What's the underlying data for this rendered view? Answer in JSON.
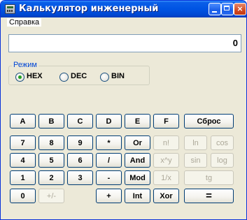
{
  "window": {
    "title": "Калькулятор инженерный",
    "controls": {
      "minimize": "minimize",
      "maximize": "maximize",
      "close": "×"
    }
  },
  "menu": {
    "items": [
      {
        "label": "Справка"
      }
    ]
  },
  "display": {
    "value": "0"
  },
  "mode": {
    "legend": "Режим",
    "options": [
      {
        "label": "HEX",
        "selected": true
      },
      {
        "label": "DEC",
        "selected": false
      },
      {
        "label": "BIN",
        "selected": false
      }
    ]
  },
  "keys": {
    "a": "A",
    "b": "B",
    "c": "C",
    "d": "D",
    "e": "E",
    "f": "F",
    "reset": "Сброс",
    "k7": "7",
    "k8": "8",
    "k9": "9",
    "mul": "*",
    "or": "Or",
    "fact": "n!",
    "ln": "ln",
    "cos": "cos",
    "k4": "4",
    "k5": "5",
    "k6": "6",
    "div": "/",
    "and": "And",
    "pow": "x^y",
    "sin": "sin",
    "log": "log",
    "k1": "1",
    "k2": "2",
    "k3": "3",
    "sub": "-",
    "mod": "Mod",
    "inv": "1/x",
    "tg": "tg",
    "k0": "0",
    "neg": "+/-",
    "add": "+",
    "int": "Int",
    "xor": "Xor",
    "eq": "="
  }
}
